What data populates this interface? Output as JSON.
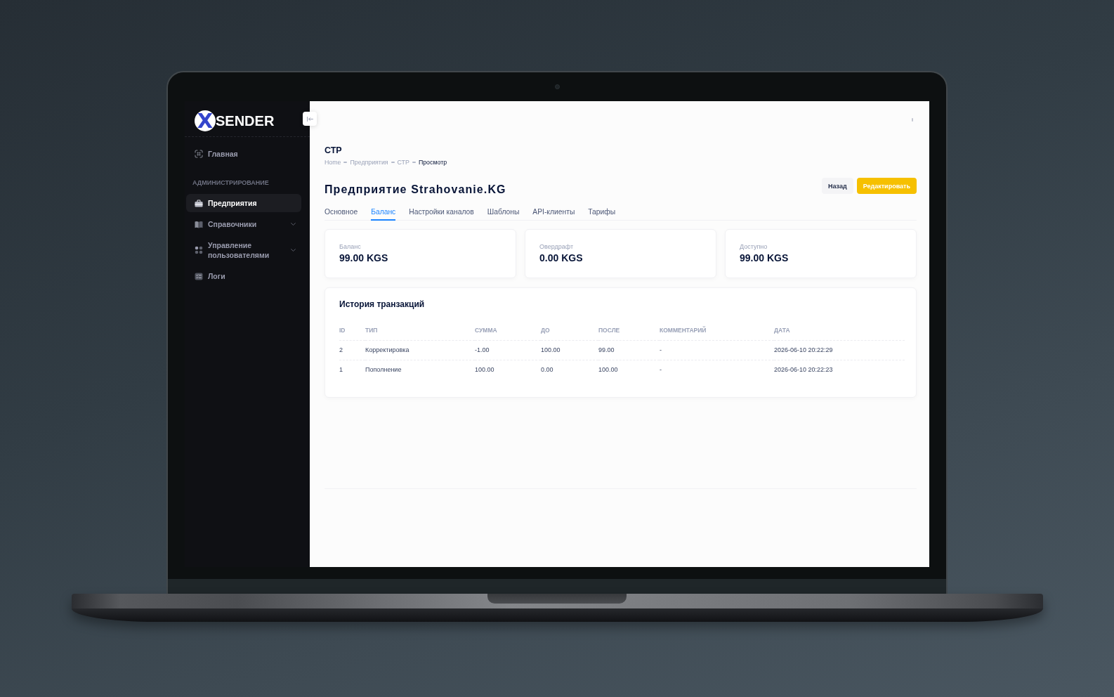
{
  "screen": {
    "sidebar": {
      "logo": {
        "mark": "X",
        "name": "SENDER"
      },
      "menu": [
        {
          "kind": "link",
          "label": "Главная",
          "selected": false
        }
      ],
      "section_title": "АДМИНИСТРИРОВАНИЕ",
      "section_items": [
        {
          "kind": "link",
          "label": "Предприятия",
          "selected": true
        },
        {
          "kind": "group",
          "label": "Справочники",
          "selected": false,
          "expanded": false
        },
        {
          "kind": "group",
          "label": "Управление пользователями",
          "selected": false,
          "expanded": false
        },
        {
          "kind": "link",
          "label": "Логи",
          "selected": false
        }
      ]
    },
    "page": {
      "title": "СТР",
      "breadcrumb": [
        {
          "label": "Home",
          "current": false
        },
        {
          "label": "Предприятия",
          "current": false
        },
        {
          "label": "СТР",
          "current": false
        },
        {
          "label": "Просмотр",
          "current": true
        }
      ],
      "heading": "Предприятие Strahovanie.KG",
      "buttons": [
        {
          "kind": "secondary",
          "label": "Назад"
        },
        {
          "kind": "primary",
          "label": "Редактировать"
        }
      ],
      "tabs": [
        {
          "label": "Основное",
          "selected": false
        },
        {
          "label": "Баланс",
          "selected": true
        },
        {
          "label": "Настройки каналов",
          "selected": false
        },
        {
          "label": "Шаблоны",
          "selected": false
        },
        {
          "label": "API-клиенты",
          "selected": false
        },
        {
          "label": "Тарифы",
          "selected": false
        }
      ],
      "stats": [
        {
          "label": "Баланс",
          "value": "99.00 KGS"
        },
        {
          "label": "Овердрафт",
          "value": "0.00 KGS"
        },
        {
          "label": "Доступно",
          "value": "99.00 KGS"
        }
      ],
      "transactions": {
        "title": "История транзакций",
        "columns": [
          "ID",
          "ТИП",
          "СУММА",
          "ДО",
          "ПОСЛЕ",
          "КОММЕНТАРИЙ",
          "ДАТА"
        ],
        "rows": [
          [
            "2",
            "Корректировка",
            "-1.00",
            "100.00",
            "99.00",
            "-",
            "2026-06-10 20:22:29"
          ],
          [
            "1",
            "Пополнение",
            "100.00",
            "0.00",
            "100.00",
            "-",
            "2026-06-10 20:22:23"
          ]
        ]
      }
    }
  }
}
